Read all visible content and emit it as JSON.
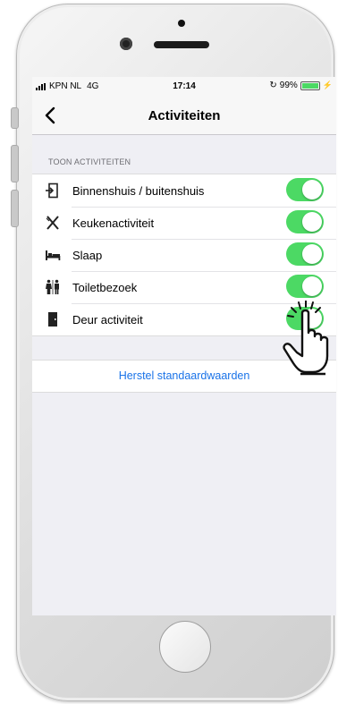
{
  "status_bar": {
    "carrier": "KPN NL",
    "network": "4G",
    "time": "17:14",
    "battery": "99%"
  },
  "nav": {
    "title": "Activiteiten"
  },
  "section": {
    "header": "TOON ACTIVITEITEN"
  },
  "activities": [
    {
      "label": "Binnenshuis / buitenshuis",
      "icon": "door-in-out-icon",
      "enabled": true
    },
    {
      "label": "Keukenactiviteit",
      "icon": "fork-knife-icon",
      "enabled": true
    },
    {
      "label": "Slaap",
      "icon": "bed-icon",
      "enabled": true
    },
    {
      "label": "Toiletbezoek",
      "icon": "toilet-icon",
      "enabled": true
    },
    {
      "label": "Deur activiteit",
      "icon": "door-icon",
      "enabled": true
    }
  ],
  "reset_label": "Herstel standaardwaarden",
  "colors": {
    "toggle_on": "#4cd964",
    "link": "#1a73e8",
    "background": "#efeff4"
  }
}
